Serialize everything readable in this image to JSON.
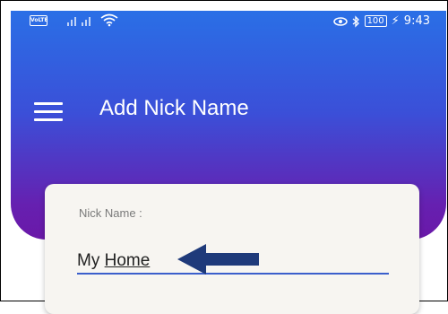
{
  "status_bar": {
    "volte_label": "VoLTE",
    "battery_level": "100",
    "time": "9:43",
    "icons": [
      "volte-icon",
      "signal-icon",
      "wifi-icon",
      "eye-icon",
      "bluetooth-icon",
      "battery-icon",
      "charging-icon"
    ]
  },
  "header": {
    "title": "Add Nick Name",
    "menu_icon": "hamburger-menu-icon"
  },
  "form": {
    "label": "Nick Name :",
    "value": "My Home",
    "value_parts": {
      "first": "My",
      "second": "Home"
    }
  },
  "colors": {
    "gradient_top": "#2a6fe6",
    "gradient_bottom": "#6a18a8",
    "input_underline": "#3b5fcc",
    "arrow": "#1f3a7a"
  }
}
